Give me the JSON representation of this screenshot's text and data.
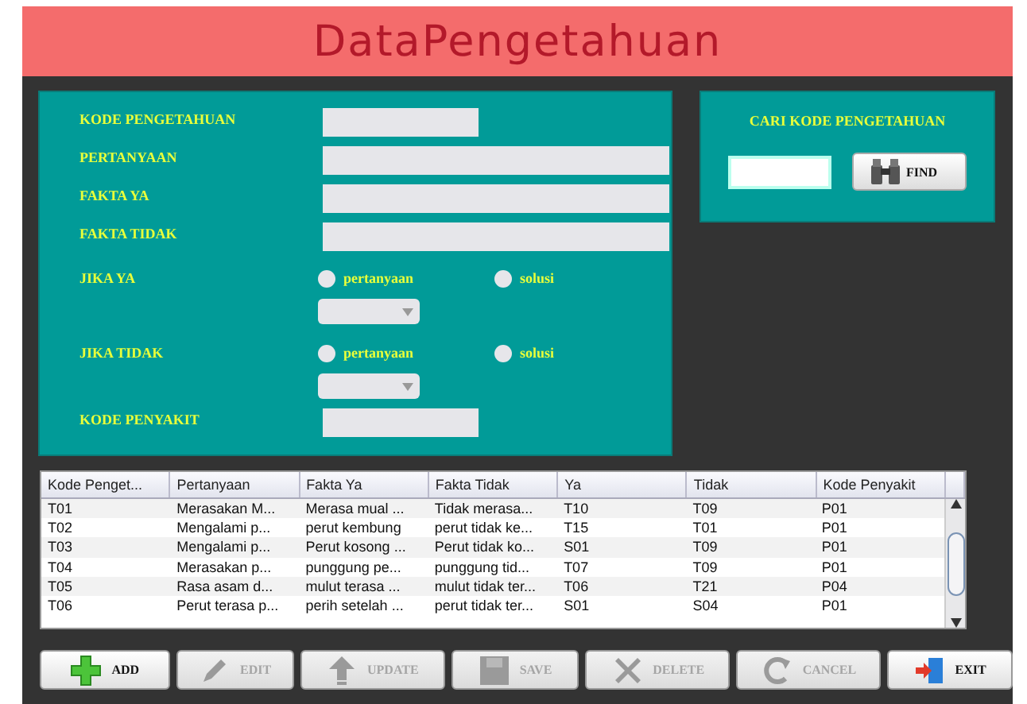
{
  "title": "DataPengetahuan",
  "form": {
    "rows": [
      {
        "kind": "code-field",
        "label": "KODE PENGETAHUAN"
      },
      {
        "kind": "text-field",
        "label": "PERTANYAAN"
      },
      {
        "kind": "text-field",
        "label": "FAKTA YA"
      },
      {
        "kind": "text-field",
        "label": "FAKTA TIDAK"
      },
      {
        "kind": "choice",
        "label": "JIKA YA",
        "options": [
          {
            "label": "pertanyaan",
            "selected": false
          },
          {
            "label": "solusi",
            "selected": false
          }
        ]
      },
      {
        "kind": "choice",
        "label": "JIKA TIDAK",
        "options": [
          {
            "label": "pertanyaan",
            "selected": false
          },
          {
            "label": "solusi",
            "selected": false
          }
        ]
      },
      {
        "kind": "code-field",
        "label": "KODE PENYAKIT"
      }
    ]
  },
  "search": {
    "title": "CARI KODE PENGETAHUAN",
    "button": "FIND"
  },
  "table": {
    "columns": [
      "Kode Penget...",
      "Pertanyaan",
      "Fakta Ya",
      "Fakta Tidak",
      "Ya",
      "Tidak",
      "Kode Penyakit"
    ],
    "rows": [
      [
        "T01",
        "Merasakan M...",
        "Merasa mual ...",
        "Tidak merasa...",
        "T10",
        "T09",
        "P01"
      ],
      [
        "T02",
        "Mengalami p...",
        "perut kembung",
        "perut tidak ke...",
        "T15",
        "T01",
        "P01"
      ],
      [
        "T03",
        "Mengalami p...",
        "Perut kosong ...",
        "Perut tidak ko...",
        "S01",
        "T09",
        "P01"
      ],
      [
        "T04",
        "Merasakan p...",
        "punggung pe...",
        "punggung tid...",
        "T07",
        "T09",
        "P01"
      ],
      [
        "T05",
        "Rasa asam d...",
        "mulut terasa ...",
        "mulut tidak ter...",
        "T06",
        "T21",
        "P04"
      ],
      [
        "T06",
        "Perut terasa p...",
        "perih setelah ...",
        "perut tidak ter...",
        "S01",
        "S04",
        "P01"
      ]
    ]
  },
  "buttons": [
    {
      "kind": "add",
      "label": "ADD",
      "disabled": false
    },
    {
      "kind": "edit",
      "label": "EDIT",
      "disabled": true
    },
    {
      "kind": "update",
      "label": "UPDATE",
      "disabled": true
    },
    {
      "kind": "save",
      "label": "SAVE",
      "disabled": true
    },
    {
      "kind": "delete",
      "label": "DELETE",
      "disabled": true
    },
    {
      "kind": "cancel",
      "label": "CANCEL",
      "disabled": true
    },
    {
      "kind": "exit",
      "label": "EXIT",
      "disabled": false
    }
  ]
}
